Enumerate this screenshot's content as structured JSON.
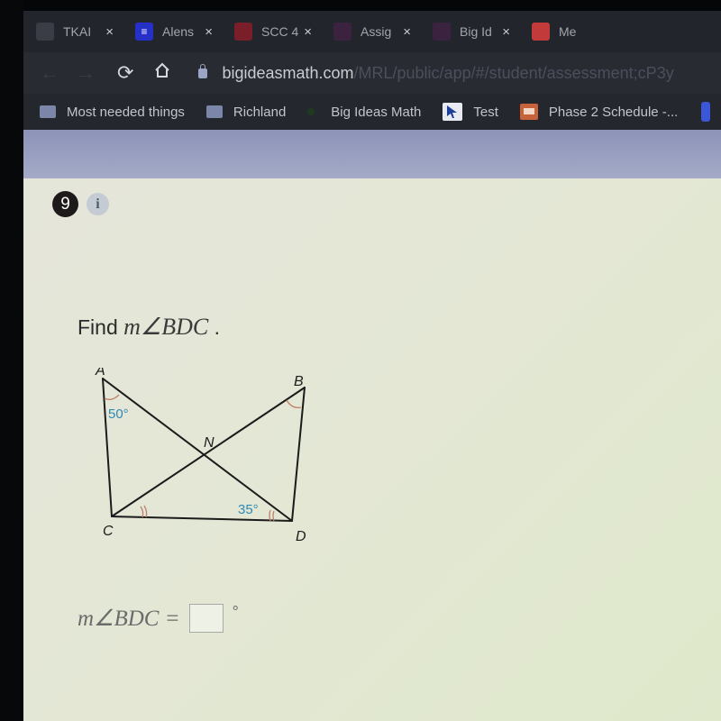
{
  "browser": {
    "tabs": [
      {
        "title": "TKAI",
        "favicon": "globe-icon",
        "favicon_color": "#3a3d46",
        "close": "×"
      },
      {
        "title": "Alens",
        "favicon": "docs-icon",
        "favicon_color": "#2430c8",
        "close": "×"
      },
      {
        "title": "SCC 4",
        "favicon": "classroom-icon",
        "favicon_color": "#7a1e2a",
        "close": "×"
      },
      {
        "title": "Assig",
        "favicon": "app-icon",
        "favicon_color": "#3b2340",
        "close": "×"
      },
      {
        "title": "Big Id",
        "favicon": "bigideas-icon",
        "favicon_color": "#3b2340",
        "close": "×"
      },
      {
        "title": "Me",
        "favicon": "app-icon",
        "favicon_color": "#c23a3a",
        "close": ""
      }
    ],
    "url": {
      "host": "bigideasmath.com",
      "path": "/MRL/public/app/#/student/assessment;cP3y"
    },
    "bookmarks": [
      {
        "label": "Most needed things",
        "icon": "folder-icon"
      },
      {
        "label": "Richland",
        "icon": "folder-icon"
      },
      {
        "label": "Big Ideas Math",
        "icon": "bigideas-icon"
      },
      {
        "label": "Test",
        "icon": "cursor-icon"
      },
      {
        "label": "Phase 2 Schedule -...",
        "icon": "slides-icon"
      }
    ]
  },
  "question": {
    "number": "9",
    "info_label": "i",
    "prompt_prefix": "Find ",
    "prompt_math": "m∠BDC",
    "prompt_suffix": " ."
  },
  "figure": {
    "points": {
      "A": "A",
      "B": "B",
      "C": "C",
      "D": "D",
      "N": "N"
    },
    "angle_labels": {
      "A": "50°",
      "D": "35°"
    },
    "colors": {
      "line": "#1b1b1b",
      "arc": "#c0806a",
      "label": "#2f8ab5"
    }
  },
  "answer": {
    "lhs": "m∠BDC =",
    "value": "",
    "unit": "°"
  }
}
